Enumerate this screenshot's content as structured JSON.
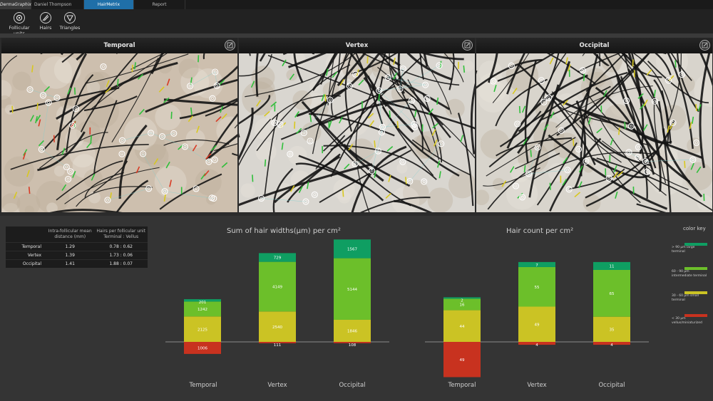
{
  "tabs": [
    {
      "label": "DermaGraphix"
    },
    {
      "label": "Daniel Thompson"
    },
    {
      "label": "HairMetrix"
    },
    {
      "label": "Report"
    }
  ],
  "tools": [
    {
      "label": "Follicular units",
      "icon": "follicular-units-icon"
    },
    {
      "label": "Hairs",
      "icon": "hairs-icon"
    },
    {
      "label": "Triangles",
      "icon": "triangles-icon"
    }
  ],
  "panels": [
    {
      "title": "Temporal"
    },
    {
      "title": "Vertex"
    },
    {
      "title": "Occipital"
    }
  ],
  "metrics_table": {
    "headers": [
      "",
      "Intra-follicular mean distance (mm)",
      "Hairs per follicular unit Terminal : Vellus"
    ],
    "rows": [
      {
        "region": "Temporal",
        "distance": "1.29",
        "ratio": "0.78 : 0.62"
      },
      {
        "region": "Vertex",
        "distance": "1.39",
        "ratio": "1.73 : 0.06"
      },
      {
        "region": "Occipital",
        "distance": "1.41",
        "ratio": "1.88 : 0.07"
      }
    ]
  },
  "colors": {
    "large": "#0f9e62",
    "intermediate": "#6cbf2a",
    "small": "#cbc324",
    "vellus": "#c8321f"
  },
  "color_key": {
    "title": "color key",
    "items": [
      {
        "label": "> 90 µm large terminal",
        "color": "#0f9e62"
      },
      {
        "label": "60 - 90 µm intermediate terminal",
        "color": "#6cbf2a"
      },
      {
        "label": "30 - 60 µm small terminal",
        "color": "#cbc324"
      },
      {
        "label": "< 30 µm vellus/miniaturized",
        "color": "#c8321f"
      }
    ]
  },
  "chart_data": [
    {
      "type": "bar",
      "title": "Sum of hair widths(µm) per cm²",
      "categories": [
        "Temporal",
        "Vertex",
        "Occipital"
      ],
      "series": [
        {
          "name": "> 90 µm large terminal",
          "values": [
            201,
            729,
            1567
          ]
        },
        {
          "name": "60 - 90 µm intermediate terminal",
          "values": [
            1242,
            4149,
            5144
          ]
        },
        {
          "name": "30 - 60 µm small terminal",
          "values": [
            2125,
            2540,
            1846
          ]
        },
        {
          "name": "< 30 µm vellus/miniaturized",
          "values": [
            -1006,
            -111,
            -108
          ]
        }
      ],
      "labels": {
        "> 90 µm large terminal": [
          "201",
          "729",
          "1567"
        ],
        "60 - 90 µm intermediate terminal": [
          "1242",
          "4149",
          "5144"
        ],
        "30 - 60 µm small terminal": [
          "2125",
          "2540",
          "1846"
        ],
        "< 30 µm vellus/miniaturized": [
          "1006",
          "111",
          "108"
        ]
      }
    },
    {
      "type": "bar",
      "title": "Hair count per cm²",
      "categories": [
        "Temporal",
        "Vertex",
        "Occipital"
      ],
      "series": [
        {
          "name": "> 90 µm large terminal",
          "values": [
            2,
            7,
            11
          ]
        },
        {
          "name": "60 - 90 µm intermediate terminal",
          "values": [
            16,
            55,
            65
          ]
        },
        {
          "name": "30 - 60 µm small terminal",
          "values": [
            44,
            49,
            35
          ]
        },
        {
          "name": "< 30 µm vellus/miniaturized",
          "values": [
            -49,
            -4,
            -4
          ]
        }
      ],
      "labels": {
        "> 90 µm large terminal": [
          "2",
          "7",
          "11"
        ],
        "60 - 90 µm intermediate terminal": [
          "16",
          "55",
          "65"
        ],
        "30 - 60 µm small terminal": [
          "44",
          "49",
          "35"
        ],
        "< 30 µm vellus/miniaturized": [
          "49",
          "4",
          "4"
        ]
      }
    }
  ]
}
